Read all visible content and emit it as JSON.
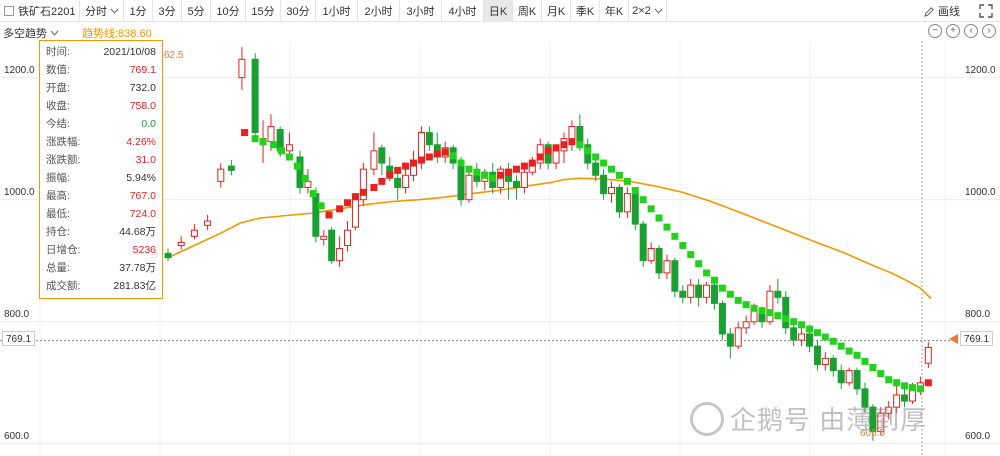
{
  "toolbar": {
    "symbol": "铁矿石2201",
    "timeframes": [
      "分时",
      "1分",
      "3分",
      "5分",
      "10分",
      "15分",
      "30分",
      "1小时",
      "2小时",
      "3小时",
      "4小时",
      "日K",
      "周K",
      "月K",
      "季K",
      "年K",
      "2×2"
    ],
    "active_timeframe": "日K",
    "draw_label": "画线"
  },
  "subbar": {
    "indicator": "多空趋势",
    "trend_label": "趋势线:838.60"
  },
  "tooltip": {
    "rows": [
      {
        "label": "时间:",
        "value": "2021/10/08",
        "color": "dark"
      },
      {
        "label": "数值:",
        "value": "769.1",
        "color": "red"
      },
      {
        "label": "开盘:",
        "value": "732.0",
        "color": "dark"
      },
      {
        "label": "收盘:",
        "value": "758.0",
        "color": "red"
      },
      {
        "label": "今结:",
        "value": "0.0",
        "color": "green"
      },
      {
        "label": "涨跌幅:",
        "value": "4.26%",
        "color": "red"
      },
      {
        "label": "涨跌额:",
        "value": "31.0",
        "color": "red"
      },
      {
        "label": "振幅:",
        "value": "5.94%",
        "color": "dark"
      },
      {
        "label": "最高:",
        "value": "767.0",
        "color": "red"
      },
      {
        "label": "最低:",
        "value": "724.0",
        "color": "red"
      },
      {
        "label": "持仓:",
        "value": "44.68万",
        "color": "dark"
      },
      {
        "label": "日增仓:",
        "value": "5236",
        "color": "red"
      },
      {
        "label": "总量:",
        "value": "37.78万",
        "color": "dark"
      },
      {
        "label": "成交额:",
        "value": "281.83亿",
        "color": "dark"
      }
    ]
  },
  "axis": {
    "y_ticks": [
      "1200.0",
      "1000.0",
      "800.0",
      "600.0"
    ],
    "crosshair_value": "769.1",
    "max_label": "62.5",
    "min_label": "605.5"
  },
  "colors": {
    "up": "#e8201f",
    "down": "#19a030",
    "trend_up": "#e8201f",
    "trend_down": "#22d11c",
    "ma_line": "#f39800",
    "accent": "#f39800"
  },
  "watermark": {
    "text": "企鹅号 由薄到厚"
  },
  "chart_data": {
    "type": "candlestick",
    "ylim": [
      580,
      1260
    ],
    "ma_line": [
      [
        0,
        905
      ],
      [
        20,
        925
      ],
      [
        40,
        945
      ],
      [
        55,
        962
      ],
      [
        70,
        970
      ],
      [
        90,
        974
      ],
      [
        110,
        978
      ],
      [
        130,
        985
      ],
      [
        150,
        992
      ],
      [
        170,
        997
      ],
      [
        190,
        1000
      ],
      [
        210,
        1004
      ],
      [
        230,
        1010
      ],
      [
        250,
        1015
      ],
      [
        270,
        1022
      ],
      [
        290,
        1028
      ],
      [
        300,
        1033
      ],
      [
        312,
        1035
      ],
      [
        330,
        1034
      ],
      [
        350,
        1030
      ],
      [
        370,
        1022
      ],
      [
        390,
        1012
      ],
      [
        410,
        998
      ],
      [
        430,
        982
      ],
      [
        450,
        965
      ],
      [
        470,
        948
      ],
      [
        490,
        931
      ],
      [
        510,
        915
      ],
      [
        530,
        896
      ],
      [
        550,
        878
      ],
      [
        560,
        867
      ],
      [
        570,
        855
      ],
      [
        578,
        838
      ]
    ],
    "candles": [
      [
        -10,
        905,
        910,
        915,
        898
      ],
      [
        0,
        912,
        905,
        920,
        900
      ],
      [
        10,
        925,
        930,
        940,
        918
      ],
      [
        20,
        940,
        950,
        960,
        935
      ],
      [
        30,
        958,
        965,
        975,
        950
      ],
      [
        40,
        1030,
        1050,
        1060,
        1020
      ],
      [
        48,
        1055,
        1048,
        1065,
        1040
      ],
      [
        56,
        1200,
        1230,
        1250,
        1180
      ],
      [
        66,
        1230,
        1110,
        1240,
        1100
      ],
      [
        72,
        1090,
        1100,
        1130,
        1060
      ],
      [
        78,
        1095,
        1120,
        1140,
        1080
      ],
      [
        85,
        1115,
        1080,
        1120,
        1070
      ],
      [
        92,
        1080,
        1090,
        1110,
        1070
      ],
      [
        100,
        1070,
        1020,
        1080,
        1010
      ],
      [
        106,
        1020,
        1030,
        1050,
        1010
      ],
      [
        112,
        1010,
        940,
        1020,
        930
      ],
      [
        118,
        935,
        940,
        950,
        925
      ],
      [
        124,
        950,
        900,
        955,
        895
      ],
      [
        130,
        900,
        920,
        940,
        890
      ],
      [
        136,
        925,
        950,
        965,
        915
      ],
      [
        142,
        955,
        1000,
        1010,
        950
      ],
      [
        148,
        1000,
        1050,
        1060,
        990
      ],
      [
        156,
        1050,
        1080,
        1110,
        1040
      ],
      [
        162,
        1085,
        1060,
        1090,
        1040
      ],
      [
        168,
        1055,
        1040,
        1070,
        1030
      ],
      [
        174,
        1035,
        1020,
        1050,
        1000
      ],
      [
        180,
        1020,
        1040,
        1060,
        1010
      ],
      [
        186,
        1040,
        1060,
        1080,
        1030
      ],
      [
        192,
        1060,
        1110,
        1120,
        1050
      ],
      [
        198,
        1110,
        1090,
        1120,
        1080
      ],
      [
        204,
        1090,
        1070,
        1110,
        1060
      ],
      [
        210,
        1070,
        1085,
        1095,
        1060
      ],
      [
        216,
        1085,
        1060,
        1090,
        1050
      ],
      [
        222,
        1060,
        1000,
        1070,
        990
      ],
      [
        228,
        1000,
        1040,
        1050,
        995
      ],
      [
        234,
        1040,
        1030,
        1060,
        1020
      ],
      [
        240,
        1030,
        1045,
        1050,
        1015
      ],
      [
        246,
        1045,
        1020,
        1060,
        1010
      ],
      [
        252,
        1020,
        1050,
        1055,
        1010
      ],
      [
        258,
        1050,
        1030,
        1060,
        1000
      ],
      [
        264,
        1030,
        1020,
        1040,
        1000
      ],
      [
        270,
        1020,
        1045,
        1050,
        1010
      ],
      [
        276,
        1045,
        1060,
        1070,
        1040
      ],
      [
        282,
        1060,
        1090,
        1100,
        1050
      ],
      [
        288,
        1090,
        1060,
        1095,
        1050
      ],
      [
        294,
        1060,
        1080,
        1090,
        1050
      ],
      [
        300,
        1080,
        1100,
        1110,
        1060
      ],
      [
        306,
        1100,
        1120,
        1130,
        1080
      ],
      [
        312,
        1120,
        1090,
        1140,
        1080
      ],
      [
        318,
        1090,
        1060,
        1100,
        1050
      ],
      [
        324,
        1060,
        1040,
        1070,
        1030
      ],
      [
        330,
        1040,
        1010,
        1050,
        1000
      ],
      [
        336,
        1010,
        1020,
        1030,
        995
      ],
      [
        342,
        1020,
        980,
        1025,
        970
      ],
      [
        348,
        980,
        1010,
        1020,
        970
      ],
      [
        354,
        1010,
        960,
        1015,
        950
      ],
      [
        360,
        960,
        900,
        965,
        890
      ],
      [
        366,
        900,
        920,
        930,
        895
      ],
      [
        372,
        920,
        880,
        925,
        870
      ],
      [
        378,
        880,
        900,
        910,
        870
      ],
      [
        384,
        900,
        850,
        905,
        840
      ],
      [
        390,
        850,
        840,
        860,
        830
      ],
      [
        396,
        840,
        860,
        870,
        830
      ],
      [
        402,
        860,
        840,
        870,
        825
      ],
      [
        408,
        840,
        860,
        865,
        830
      ],
      [
        414,
        860,
        830,
        870,
        820
      ],
      [
        420,
        830,
        780,
        835,
        770
      ],
      [
        426,
        780,
        760,
        790,
        740
      ],
      [
        432,
        760,
        790,
        800,
        755
      ],
      [
        438,
        790,
        800,
        810,
        780
      ],
      [
        444,
        800,
        820,
        830,
        795
      ],
      [
        450,
        820,
        800,
        825,
        790
      ],
      [
        456,
        800,
        850,
        860,
        795
      ],
      [
        462,
        850,
        840,
        870,
        830
      ],
      [
        468,
        840,
        790,
        850,
        780
      ],
      [
        474,
        790,
        770,
        800,
        760
      ],
      [
        480,
        770,
        780,
        790,
        760
      ],
      [
        486,
        780,
        760,
        795,
        750
      ],
      [
        492,
        760,
        730,
        770,
        720
      ],
      [
        498,
        730,
        740,
        750,
        720
      ],
      [
        504,
        740,
        720,
        745,
        710
      ],
      [
        510,
        720,
        700,
        730,
        690
      ],
      [
        516,
        700,
        720,
        725,
        695
      ],
      [
        522,
        720,
        690,
        725,
        680
      ],
      [
        528,
        690,
        660,
        700,
        650
      ],
      [
        534,
        660,
        620,
        665,
        605
      ],
      [
        540,
        620,
        650,
        660,
        615
      ],
      [
        546,
        650,
        660,
        670,
        640
      ],
      [
        552,
        660,
        680,
        700,
        650
      ],
      [
        558,
        680,
        670,
        690,
        660
      ],
      [
        564,
        670,
        690,
        700,
        665
      ],
      [
        570,
        690,
        700,
        710,
        680
      ],
      [
        576,
        732,
        758,
        767,
        724
      ]
    ],
    "trend_dots": [
      [
        58,
        1110,
        "up"
      ],
      [
        66,
        1100,
        "down"
      ],
      [
        72,
        1095,
        "down"
      ],
      [
        80,
        1090,
        "down"
      ],
      [
        86,
        1080,
        "down"
      ],
      [
        92,
        1070,
        "down"
      ],
      [
        98,
        1055,
        "down"
      ],
      [
        104,
        1035,
        "down"
      ],
      [
        110,
        1010,
        "down"
      ],
      [
        116,
        990,
        "down"
      ],
      [
        122,
        975,
        "up"
      ],
      [
        130,
        985,
        "up"
      ],
      [
        136,
        995,
        "up"
      ],
      [
        142,
        1005,
        "up"
      ],
      [
        148,
        1012,
        "up"
      ],
      [
        156,
        1020,
        "up"
      ],
      [
        162,
        1030,
        "up"
      ],
      [
        168,
        1040,
        "up"
      ],
      [
        174,
        1048,
        "up"
      ],
      [
        180,
        1055,
        "up"
      ],
      [
        186,
        1060,
        "up"
      ],
      [
        192,
        1065,
        "up"
      ],
      [
        198,
        1070,
        "up"
      ],
      [
        204,
        1075,
        "up"
      ],
      [
        210,
        1078,
        "up"
      ],
      [
        216,
        1072,
        "down"
      ],
      [
        222,
        1060,
        "down"
      ],
      [
        228,
        1050,
        "down"
      ],
      [
        234,
        1045,
        "down"
      ],
      [
        240,
        1040,
        "down"
      ],
      [
        246,
        1035,
        "down"
      ],
      [
        252,
        1040,
        "up"
      ],
      [
        258,
        1045,
        "up"
      ],
      [
        264,
        1050,
        "up"
      ],
      [
        270,
        1055,
        "up"
      ],
      [
        276,
        1060,
        "up"
      ],
      [
        282,
        1070,
        "up"
      ],
      [
        288,
        1080,
        "up"
      ],
      [
        294,
        1085,
        "up"
      ],
      [
        300,
        1090,
        "up"
      ],
      [
        306,
        1095,
        "up"
      ],
      [
        312,
        1090,
        "down"
      ],
      [
        318,
        1080,
        "down"
      ],
      [
        324,
        1070,
        "down"
      ],
      [
        330,
        1060,
        "down"
      ],
      [
        336,
        1050,
        "down"
      ],
      [
        342,
        1040,
        "down"
      ],
      [
        348,
        1030,
        "down"
      ],
      [
        354,
        1015,
        "down"
      ],
      [
        360,
        1000,
        "down"
      ],
      [
        366,
        985,
        "down"
      ],
      [
        372,
        970,
        "down"
      ],
      [
        378,
        955,
        "down"
      ],
      [
        384,
        940,
        "down"
      ],
      [
        390,
        925,
        "down"
      ],
      [
        396,
        910,
        "down"
      ],
      [
        402,
        895,
        "down"
      ],
      [
        408,
        880,
        "down"
      ],
      [
        414,
        868,
        "down"
      ],
      [
        420,
        855,
        "down"
      ],
      [
        426,
        845,
        "down"
      ],
      [
        432,
        835,
        "down"
      ],
      [
        438,
        828,
        "down"
      ],
      [
        444,
        822,
        "down"
      ],
      [
        450,
        818,
        "down"
      ],
      [
        456,
        815,
        "down"
      ],
      [
        462,
        810,
        "down"
      ],
      [
        468,
        805,
        "down"
      ],
      [
        474,
        800,
        "down"
      ],
      [
        480,
        795,
        "down"
      ],
      [
        486,
        788,
        "down"
      ],
      [
        492,
        782,
        "down"
      ],
      [
        498,
        775,
        "down"
      ],
      [
        504,
        768,
        "down"
      ],
      [
        510,
        760,
        "down"
      ],
      [
        516,
        752,
        "down"
      ],
      [
        522,
        745,
        "down"
      ],
      [
        528,
        735,
        "down"
      ],
      [
        534,
        725,
        "down"
      ],
      [
        540,
        715,
        "down"
      ],
      [
        546,
        705,
        "down"
      ],
      [
        552,
        700,
        "down"
      ],
      [
        558,
        695,
        "down"
      ],
      [
        564,
        692,
        "down"
      ],
      [
        570,
        690,
        "down"
      ],
      [
        576,
        700,
        "up"
      ]
    ]
  }
}
